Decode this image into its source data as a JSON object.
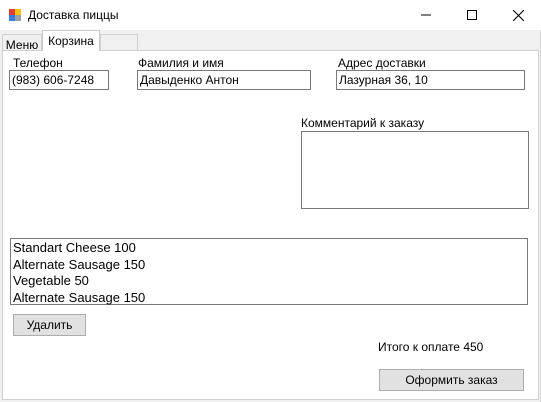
{
  "window": {
    "title": "Доставка пиццы",
    "accent": "#0078d7"
  },
  "tabs": [
    {
      "label": "Меню"
    },
    {
      "label": "Корзина"
    }
  ],
  "form": {
    "phone_label": "Телефон",
    "phone_value": "(983) 606-7248",
    "name_label": "Фамилия и имя",
    "name_value": "Давыденко Антон",
    "address_label": "Адрес доставки",
    "address_value": "Лазурная 36, 10",
    "comment_label": "Комментарий к заказу",
    "comment_value": ""
  },
  "order_items": [
    "Standart Cheese 100",
    "Alternate Sausage 150",
    "Vegetable 50",
    "Alternate Sausage 150"
  ],
  "actions": {
    "delete_label": "Удалить",
    "total_text": "Итого к оплате 450",
    "checkout_label": "Оформить заказ"
  }
}
